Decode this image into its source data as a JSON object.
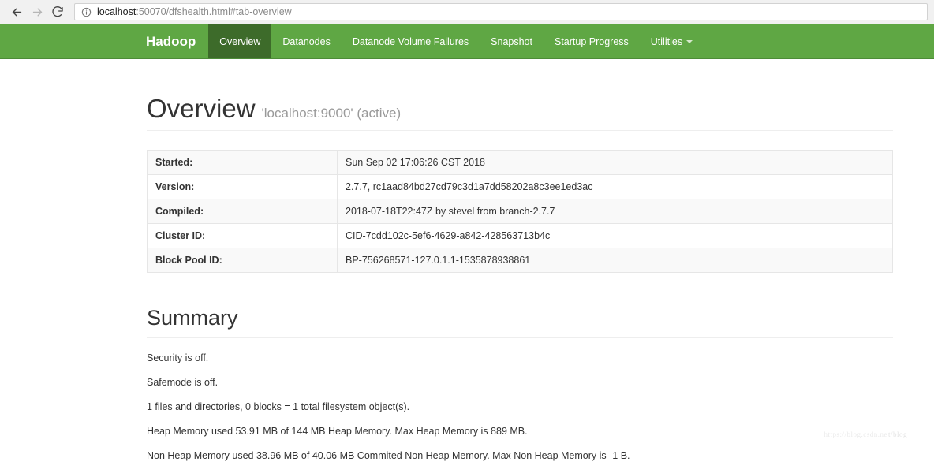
{
  "browser": {
    "back_icon": "back-arrow-icon",
    "forward_icon": "forward-arrow-icon",
    "reload_icon": "reload-icon",
    "site_info_icon": "info-circle-icon",
    "url_host": "localhost",
    "url_path": ":50070/dfshealth.html#tab-overview",
    "url_full": "localhost:50070/dfshealth.html#tab-overview"
  },
  "navbar": {
    "brand": "Hadoop",
    "accent_color": "#5fa744",
    "active_color": "#3d6b2a",
    "items": [
      {
        "label": "Overview",
        "active": true
      },
      {
        "label": "Datanodes",
        "active": false
      },
      {
        "label": "Datanode Volume Failures",
        "active": false
      },
      {
        "label": "Snapshot",
        "active": false
      },
      {
        "label": "Startup Progress",
        "active": false
      },
      {
        "label": "Utilities",
        "active": false,
        "has_caret": true
      }
    ]
  },
  "overview": {
    "title": "Overview",
    "subtitle": "'localhost:9000' (active)",
    "rows": [
      {
        "label": "Started:",
        "value": "Sun Sep 02 17:06:26 CST 2018"
      },
      {
        "label": "Version:",
        "value": "2.7.7, rc1aad84bd27cd79c3d1a7dd58202a8c3ee1ed3ac"
      },
      {
        "label": "Compiled:",
        "value": "2018-07-18T22:47Z by stevel from branch-2.7.7"
      },
      {
        "label": "Cluster ID:",
        "value": "CID-7cdd102c-5ef6-4629-a842-428563713b4c"
      },
      {
        "label": "Block Pool ID:",
        "value": "BP-756268571-127.0.1.1-1535878938861"
      }
    ]
  },
  "summary": {
    "title": "Summary",
    "lines": [
      "Security is off.",
      "Safemode is off.",
      "1 files and directories, 0 blocks = 1 total filesystem object(s).",
      "Heap Memory used 53.91 MB of 144 MB Heap Memory. Max Heap Memory is 889 MB.",
      "Non Heap Memory used 38.96 MB of 40.06 MB Commited Non Heap Memory. Max Non Heap Memory is -1 B."
    ]
  },
  "watermark": {
    "url": "https://blog.csdn.ne",
    "tag": "t/blog"
  }
}
